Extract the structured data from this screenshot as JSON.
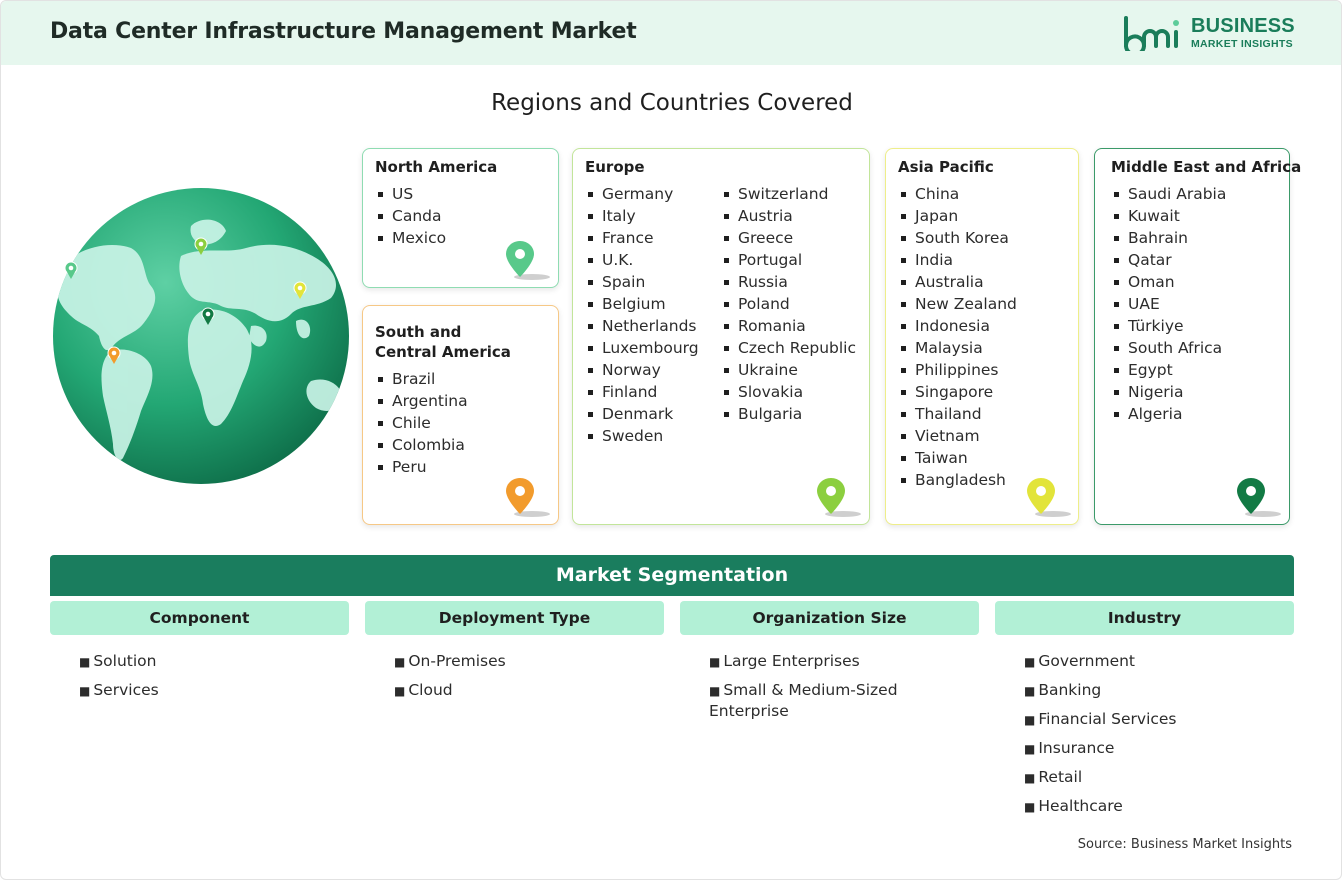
{
  "header": {
    "title": "Data Center Infrastructure Management Market",
    "logo_line1": "BUSINESS",
    "logo_line2": "MARKET INSIGHTS"
  },
  "regions": {
    "title": "Regions and Countries Covered",
    "north_america": {
      "name": "North America",
      "countries": [
        "US",
        "Canda",
        "Mexico"
      ]
    },
    "south_central_america": {
      "name_line1": "South and",
      "name_line2": "Central America",
      "countries": [
        "Brazil",
        "Argentina",
        "Chile",
        "Colombia",
        "Peru"
      ]
    },
    "europe": {
      "name": "Europe",
      "col1": [
        "Germany",
        "Italy",
        "France",
        "U.K.",
        "Spain",
        "Belgium",
        "Netherlands",
        "Luxembourg",
        "Norway",
        "Finland",
        "Denmark",
        "Sweden"
      ],
      "col2": [
        "Switzerland",
        "Austria",
        "Greece",
        "Portugal",
        "Russia",
        "Poland",
        "Romania",
        "Czech Republic",
        "Ukraine",
        "Slovakia",
        "Bulgaria"
      ]
    },
    "asia_pacific": {
      "name": "Asia Pacific",
      "countries": [
        "China",
        "Japan",
        "South Korea",
        "India",
        "Australia",
        "New Zealand",
        "Indonesia",
        "Malaysia",
        "Philippines",
        "Singapore",
        "Thailand",
        "Vietnam",
        "Taiwan",
        "Bangladesh"
      ]
    },
    "middle_east_africa": {
      "name": "Middle East and Africa",
      "countries": [
        "Saudi Arabia",
        "Kuwait",
        "Bahrain",
        "Qatar",
        "Oman",
        "UAE",
        "Türkiye",
        "South Africa",
        "Egypt",
        "Nigeria",
        "Algeria"
      ]
    }
  },
  "segmentation": {
    "title": "Market Segmentation",
    "component": {
      "label": "Component",
      "items": [
        "Solution",
        "Services"
      ]
    },
    "deployment": {
      "label": "Deployment Type",
      "items": [
        "On-Premises",
        "Cloud"
      ]
    },
    "org_size": {
      "label": "Organization Size",
      "items": [
        "Large Enterprises",
        "Small & Medium-Sized Enterprise"
      ]
    },
    "industry": {
      "label": "Industry",
      "items": [
        "Government",
        "Banking",
        "Financial Services",
        "Insurance",
        "Retail",
        "Healthcare"
      ]
    }
  },
  "source": "Source: Business Market Insights",
  "colors": {
    "brand_green": "#1a7d5e",
    "header_bg": "#e6f7ee",
    "seg_head_bg": "#b2f0d6",
    "north_america": "#58c98a",
    "south_central_america": "#f29b2c",
    "europe": "#8ccf3f",
    "asia_pacific": "#e2e43a",
    "middle_east_africa": "#127a44"
  }
}
